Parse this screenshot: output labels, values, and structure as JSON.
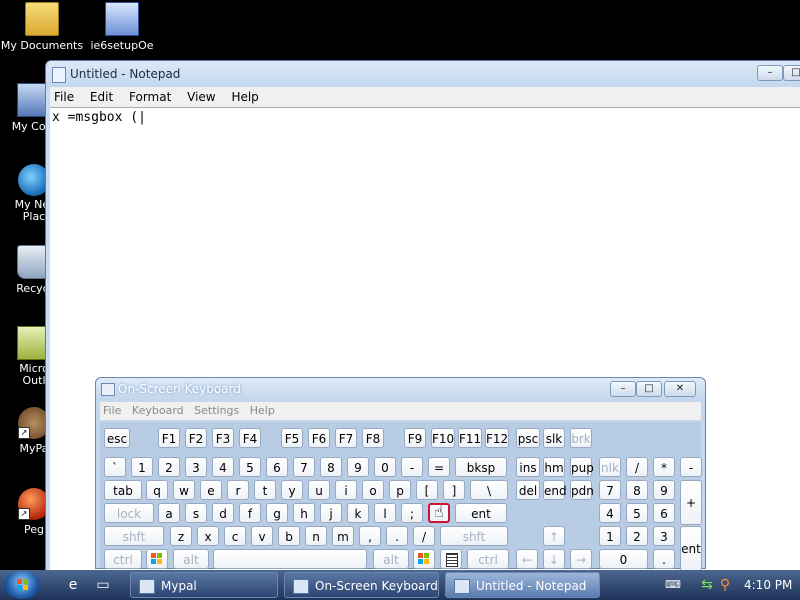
{
  "desktop": {
    "icons": [
      {
        "label": "My Documents",
        "icon": "folder-icon"
      },
      {
        "label": "ie6setupOe",
        "icon": "installer-icon"
      },
      {
        "label": "My Com",
        "icon": "computer-icon"
      },
      {
        "label": "My Net\nPlac",
        "icon": "network-globe-icon"
      },
      {
        "label": "Recycl",
        "icon": "recycle-bin-icon"
      },
      {
        "label": "Micro\nOutl",
        "icon": "outlook-icon"
      },
      {
        "label": "MyPa",
        "icon": "mypal-icon"
      },
      {
        "label": "Peg",
        "icon": "pegasus-icon"
      }
    ]
  },
  "notepad": {
    "title": "Untitled - Notepad",
    "menu": [
      "File",
      "Edit",
      "Format",
      "View",
      "Help"
    ],
    "content": "x =msgbox (|",
    "controls": {
      "minimize": "–",
      "maximize": "□",
      "close": "✕"
    }
  },
  "osk": {
    "title": "On-Screen Keyboard",
    "menu": [
      "File",
      "Keyboard",
      "Settings",
      "Help"
    ],
    "controls": {
      "minimize": "–",
      "maximize": "□",
      "close": "✕"
    },
    "keys": {
      "row1": [
        "esc",
        "F1",
        "F2",
        "F3",
        "F4",
        "F5",
        "F6",
        "F7",
        "F8",
        "F9",
        "F10",
        "F11",
        "F12",
        "psc",
        "slk",
        "brk"
      ],
      "row2": [
        "`",
        "1",
        "2",
        "3",
        "4",
        "5",
        "6",
        "7",
        "8",
        "9",
        "0",
        "-",
        "=",
        "bksp",
        "ins",
        "hm",
        "pup",
        "nlk",
        "/",
        "*",
        "-"
      ],
      "row3": [
        "tab",
        "q",
        "w",
        "e",
        "r",
        "t",
        "y",
        "u",
        "i",
        "o",
        "p",
        "[",
        "]",
        "\\",
        "del",
        "end",
        "pdn",
        "7",
        "8",
        "9",
        "+"
      ],
      "row4": [
        "lock",
        "a",
        "s",
        "d",
        "f",
        "g",
        "h",
        "j",
        "k",
        "l",
        ";",
        "",
        "ent",
        "4",
        "5",
        "6"
      ],
      "row5": [
        "shft",
        "z",
        "x",
        "c",
        "v",
        "b",
        "n",
        "m",
        ",",
        ".",
        "/",
        "shft",
        "↑",
        "1",
        "2",
        "3",
        "ent"
      ],
      "row6": [
        "ctrl",
        "",
        "alt",
        "",
        "alt",
        "",
        "",
        "ctrl",
        "←",
        "↓",
        "→",
        "0",
        "."
      ]
    },
    "highlighted_key": "'"
  },
  "taskbar": {
    "tasks": [
      {
        "label": "Mypal",
        "active": false
      },
      {
        "label": "On-Screen Keyboard",
        "active": false
      },
      {
        "label": "Untitled - Notepad",
        "active": true
      }
    ],
    "clock": "4:10 PM"
  },
  "colors": {
    "taskbar": "#2c4572",
    "window_frame": "#c9dcf1",
    "highlight": "#c8163a"
  }
}
